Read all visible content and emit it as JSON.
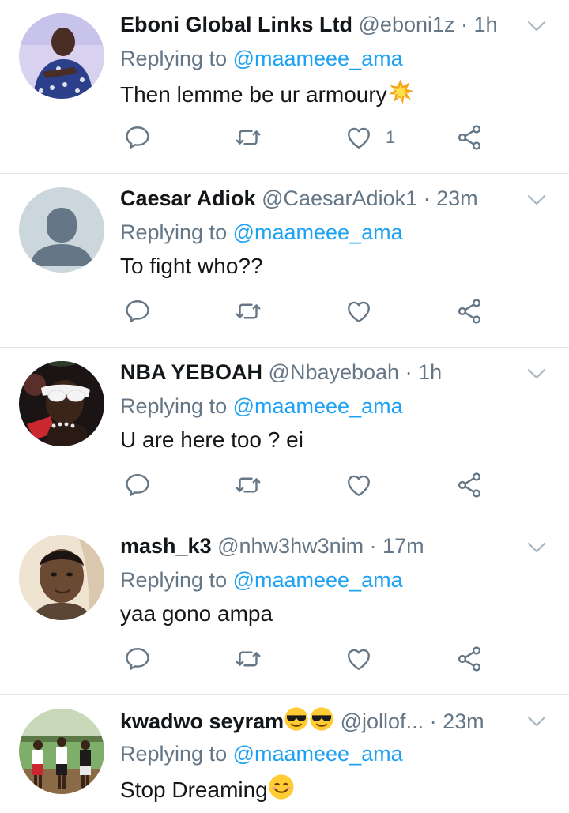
{
  "tweets": [
    {
      "name": "Eboni Global Links Ltd",
      "handle": "@eboni1z",
      "time": "· 1h",
      "replying_prefix": "Replying to ",
      "replying_to": "@maameee_ama",
      "text": "Then lemme be ur armoury",
      "text_emoji": "collision-emoji",
      "like_count": "1",
      "avatar": "photo-person-patterned-shirt"
    },
    {
      "name": "Caesar Adiok",
      "handle": "@CaesarAdiok1",
      "time": "· 23m",
      "replying_prefix": "Replying to ",
      "replying_to": "@maameee_ama",
      "text": "To fight who??",
      "text_emoji": "",
      "like_count": "",
      "avatar": "default-profile-silhouette"
    },
    {
      "name": "NBA YEBOAH",
      "handle": "@Nbayeboah",
      "time": "· 1h",
      "replying_prefix": "Replying to ",
      "replying_to": "@maameee_ama",
      "text": "U are here too ? ei",
      "text_emoji": "",
      "like_count": "",
      "avatar": "photo-person-white-sunglasses"
    },
    {
      "name": "mash_k3",
      "handle": "@nhw3hw3nim",
      "time": "· 17m",
      "replying_prefix": "Replying to ",
      "replying_to": "@maameee_ama",
      "text": "yaa gono ampa",
      "text_emoji": "",
      "like_count": "",
      "avatar": "photo-person-selfie"
    },
    {
      "name": "kwadwo seyram",
      "name_emoji": "smiling-face-with-sunglasses-x2",
      "handle": "@jollof...",
      "time": "· 23m",
      "replying_prefix": "Replying to ",
      "replying_to": "@maameee_ama",
      "text": "Stop Dreaming",
      "text_emoji": "smiling-face-emoji",
      "like_count": "",
      "avatar": "photo-group-outdoor"
    }
  ],
  "icons": [
    "reply-icon",
    "retweet-icon",
    "like-icon",
    "share-icon",
    "chevron-down-icon"
  ],
  "colors": {
    "link": "#1da1f2",
    "muted": "#657786",
    "text": "#14171a",
    "divider": "#e1e8ed"
  }
}
